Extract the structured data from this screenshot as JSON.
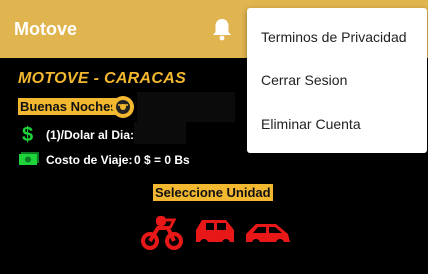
{
  "appbar": {
    "title": "Motove",
    "bell_icon": "bell-icon"
  },
  "main": {
    "title": "MOTOVE - CARACAS",
    "greeting": "Buenas Noches",
    "greeting_icon": "motorcycle-helmet-icon",
    "dollar_label": "(1)/Dolar al Dia:",
    "dollar_icon": "dollar-icon",
    "cost_label": "Costo de Viaje:",
    "cost_value": "0 $ = 0 Bs",
    "money_icon": "money-bill-icon",
    "section_title": "Seleccione Unidad",
    "vehicles": [
      "motorcycle-icon",
      "car-icon",
      "small-car-icon"
    ]
  },
  "menu": {
    "items": [
      {
        "label": "Terminos de Privacidad"
      },
      {
        "label": "Cerrar Sesion"
      },
      {
        "label": "Eliminar Cuenta"
      }
    ]
  },
  "colors": {
    "appbar": "#E0B44F",
    "accent": "#F2B830",
    "vehicle": "#E81818",
    "green": "#1FD43A"
  }
}
